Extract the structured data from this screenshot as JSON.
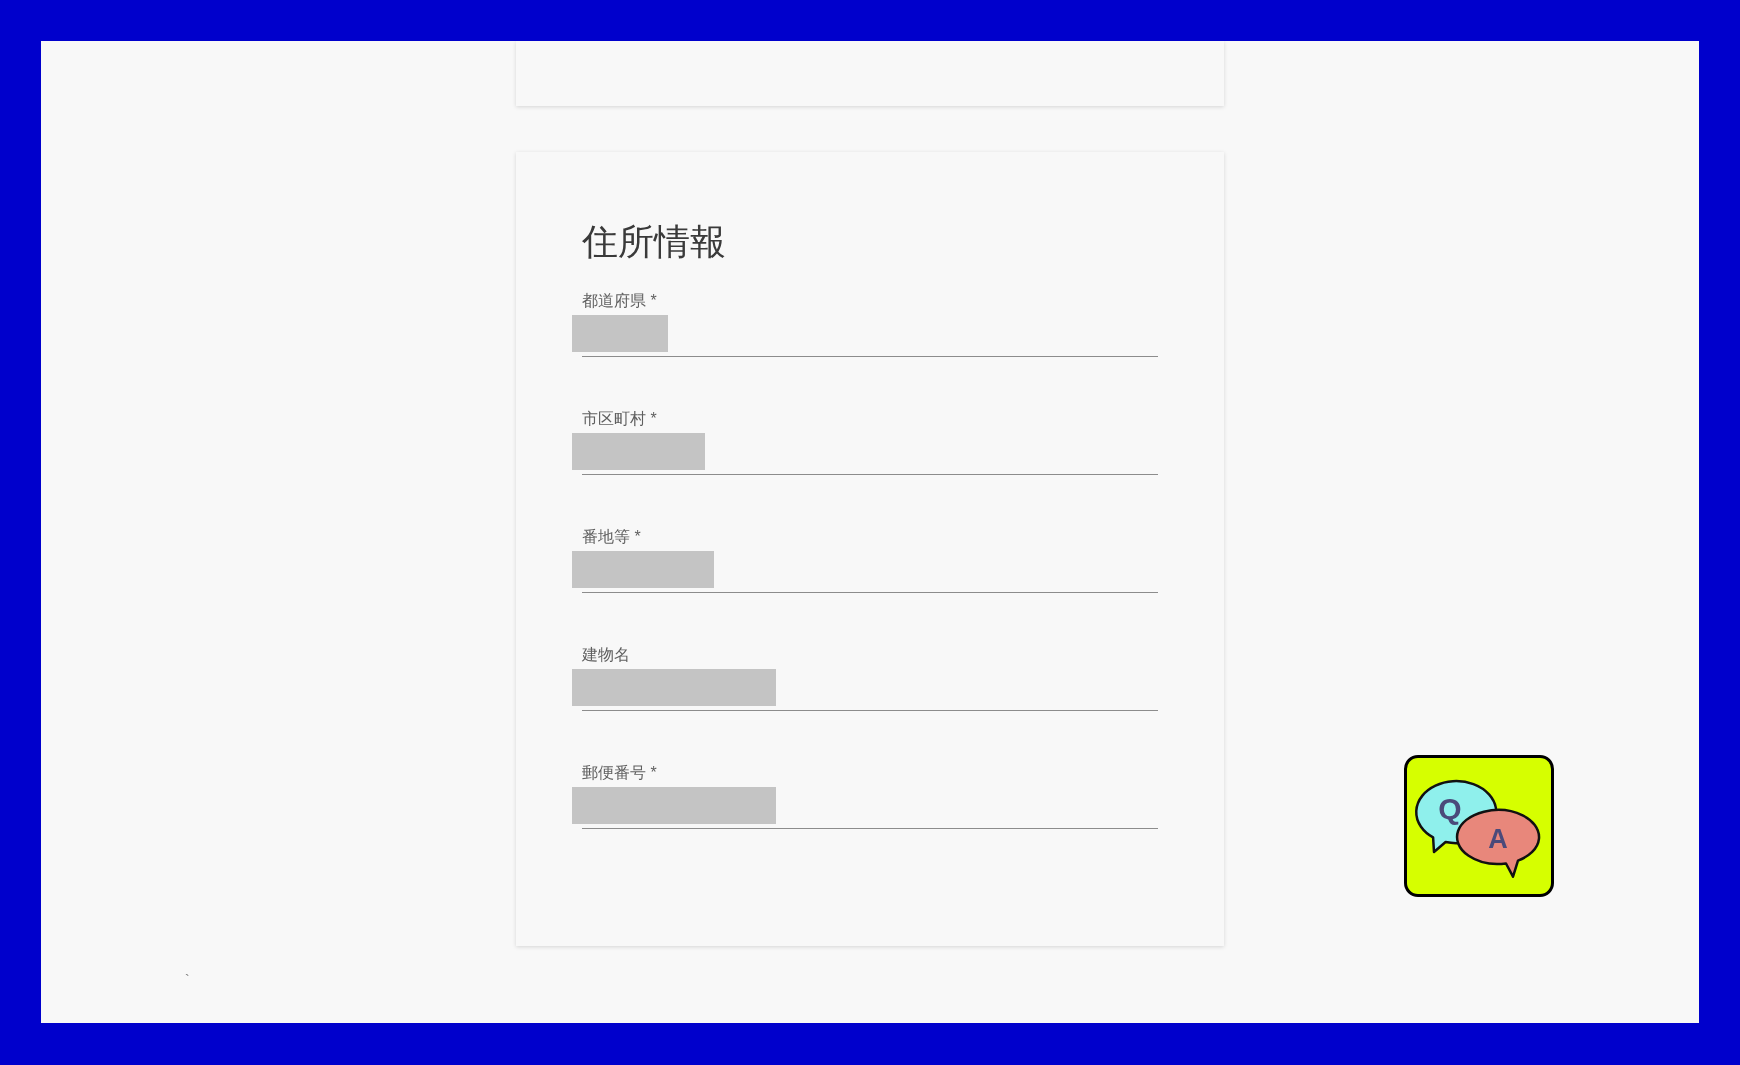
{
  "address_section": {
    "title": "住所情報",
    "fields": [
      {
        "label": "都道府県 *",
        "redacted": true
      },
      {
        "label": "市区町村 *",
        "redacted": true
      },
      {
        "label": "番地等 *",
        "redacted": true
      },
      {
        "label": "建物名",
        "redacted": true
      },
      {
        "label": "郵便番号 *",
        "redacted": true
      }
    ]
  },
  "qa_button": {
    "question": "Q",
    "answer": "A"
  },
  "stray_mark": "`"
}
